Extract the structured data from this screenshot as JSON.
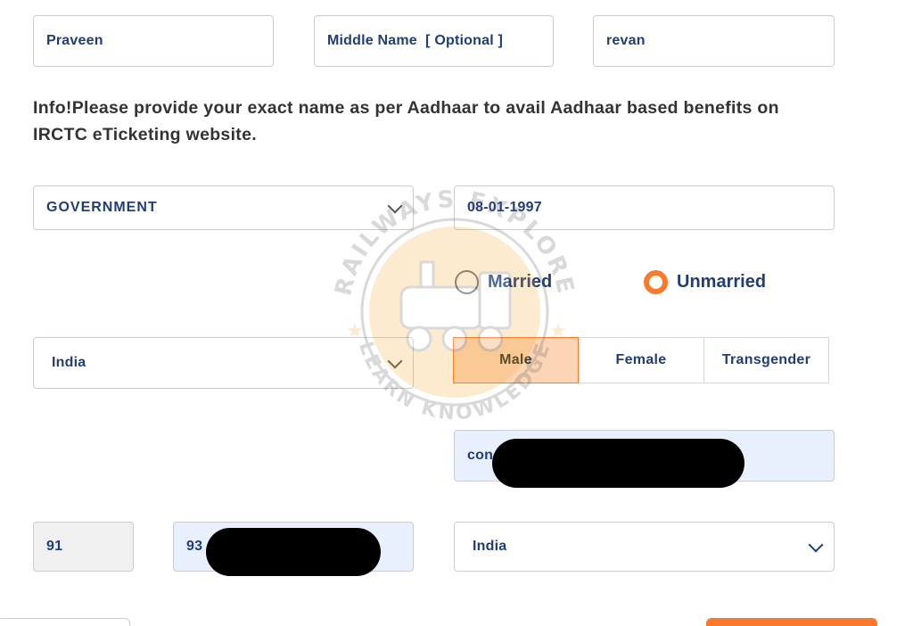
{
  "name": {
    "first_name": "Praveen",
    "middle_name_placeholder": "Middle Name  [ Optional ]",
    "last_name": "revan"
  },
  "info_message": "Info!Please provide your exact name as per Aadhaar to avail Aadhaar based benefits on IRCTC eTicketing website.",
  "occupation": {
    "selected": "GOVERNMENT"
  },
  "dob": {
    "value": "08-01-1997"
  },
  "marital_status": {
    "options": [
      "Married",
      "Unmarried"
    ],
    "selected": "Unmarried"
  },
  "country": {
    "selected": "India"
  },
  "gender": {
    "options": [
      "Male",
      "Female",
      "Transgender"
    ],
    "selected": "Male"
  },
  "email": {
    "visible_prefix": "con"
  },
  "phone": {
    "isd_code": "91",
    "visible_prefix": "93"
  },
  "nationality": {
    "selected": "India"
  },
  "watermark": {
    "top_text": "RAILWAYS EXPLORE",
    "bottom_text": "LEARN KNOWLEDGE"
  },
  "colors": {
    "accent": "#fb792b",
    "text_blue": "#213d77",
    "autofill_bg": "#e8f0fe"
  }
}
